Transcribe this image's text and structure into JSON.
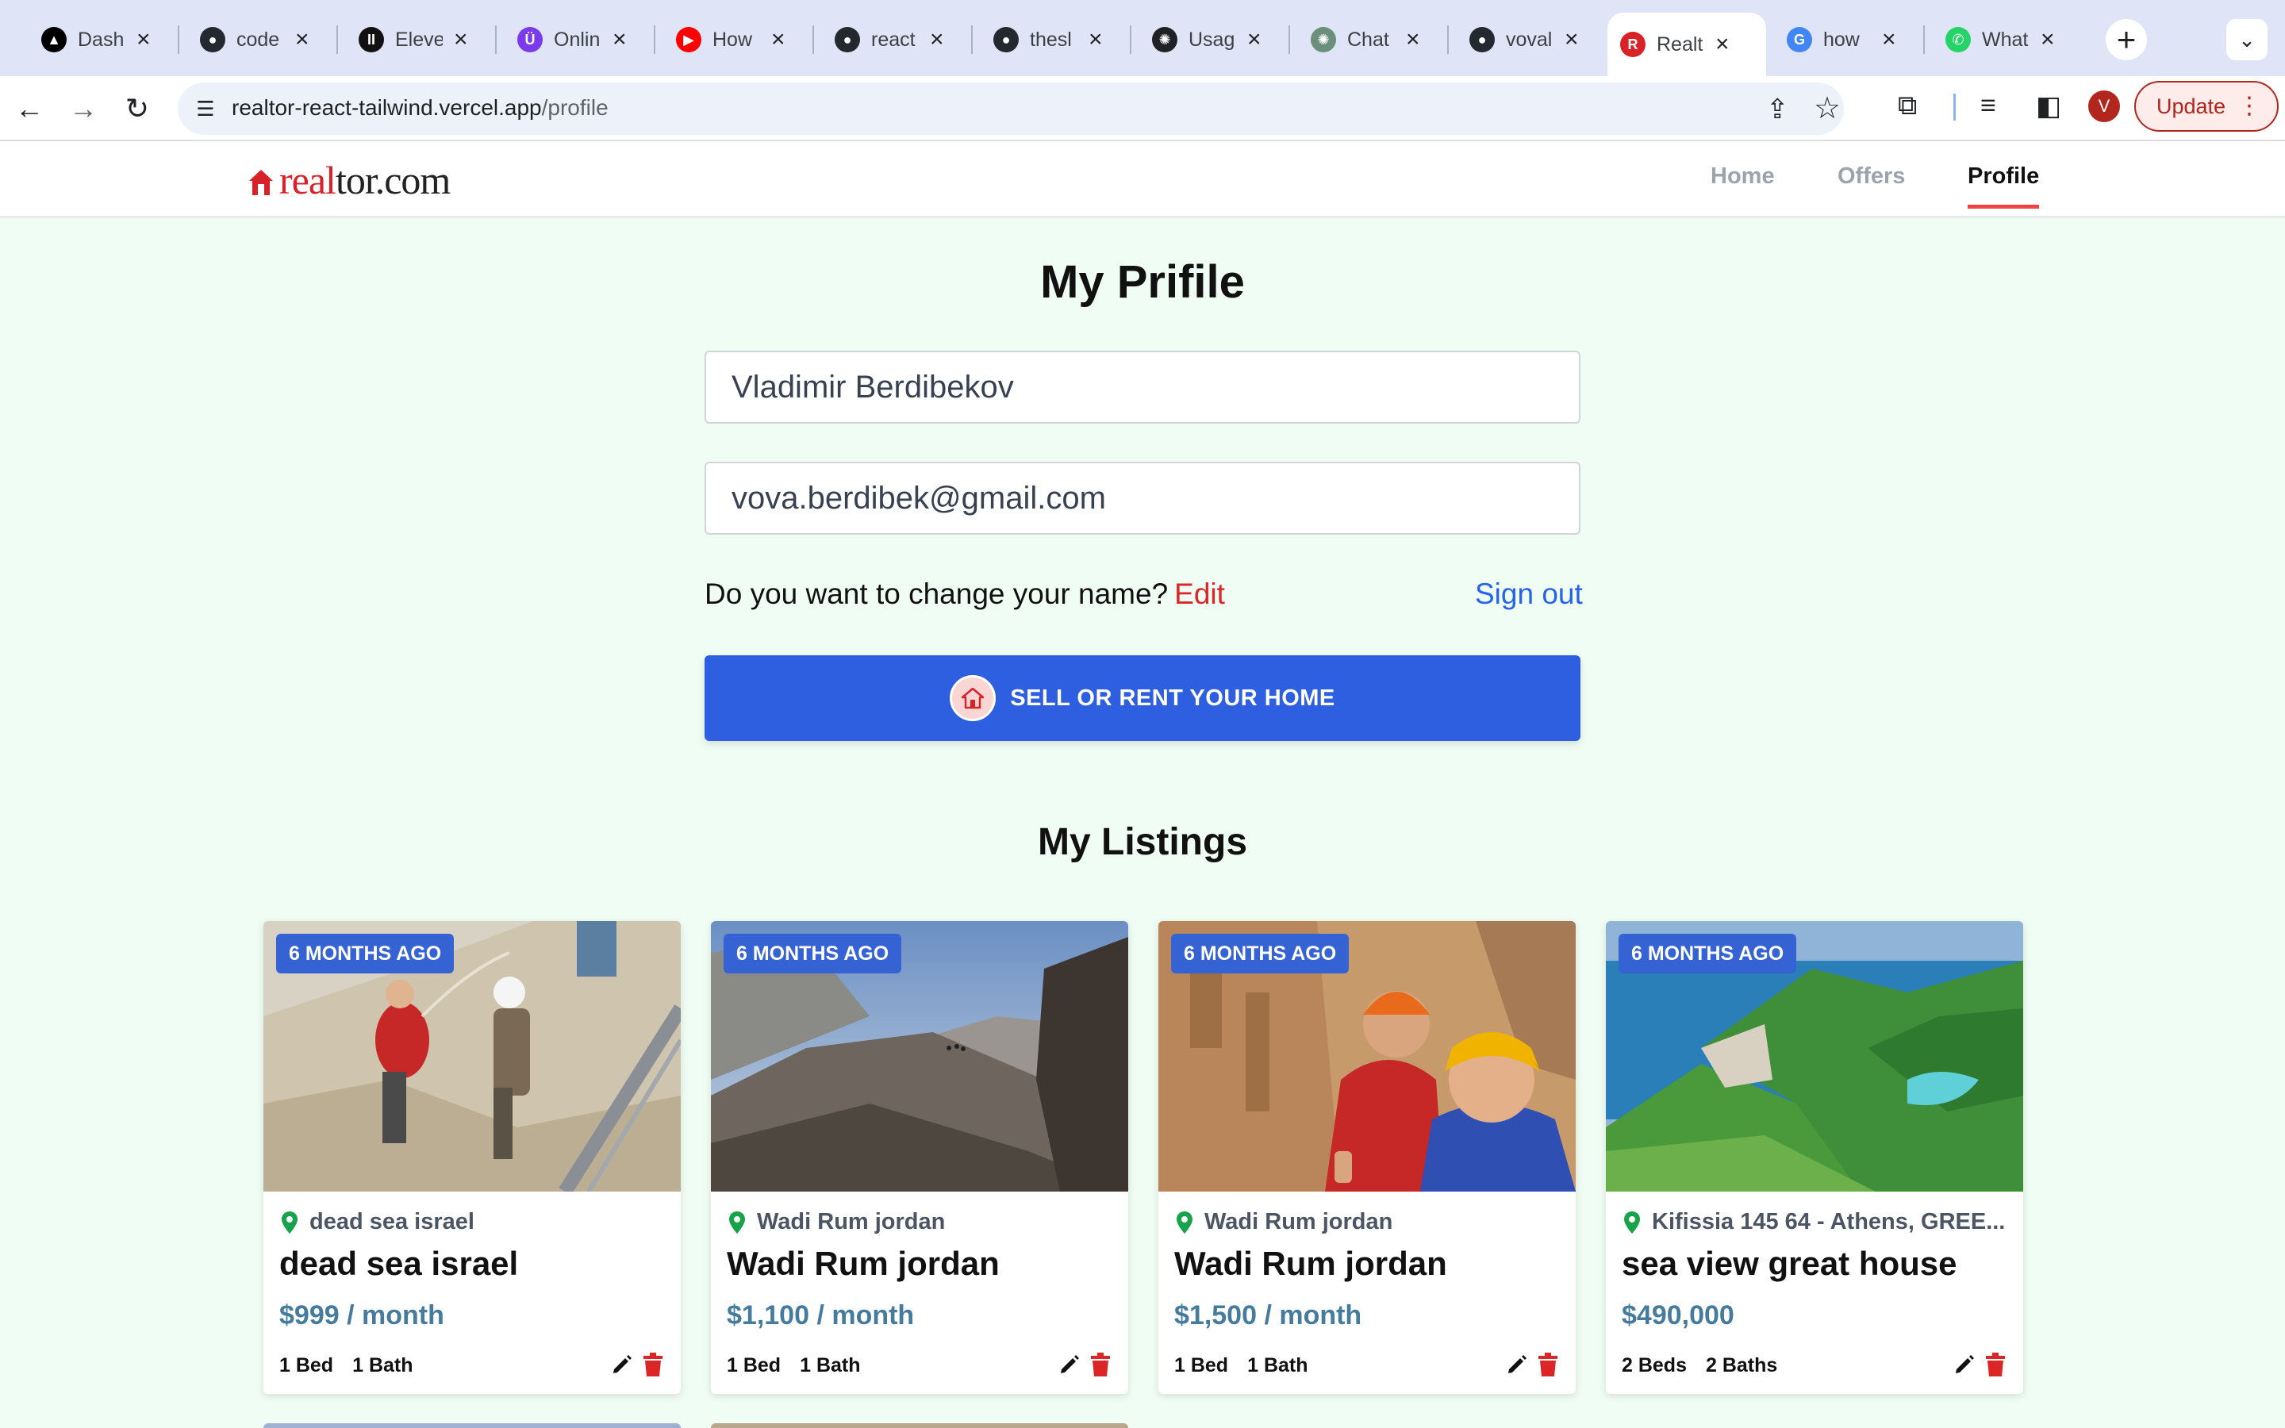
{
  "browser": {
    "tabs": [
      {
        "title": "Dash",
        "icon": "vercel-icon",
        "color": "#000000",
        "glyph": "▲"
      },
      {
        "title": "code",
        "icon": "github-icon",
        "color": "#24292f",
        "glyph": "●"
      },
      {
        "title": "Eleve",
        "icon": "elevenlabs-icon",
        "color": "#111111",
        "glyph": "II"
      },
      {
        "title": "Onlin",
        "icon": "online-icon",
        "color": "#7c3aed",
        "glyph": "Ü"
      },
      {
        "title": "How",
        "icon": "youtube-icon",
        "color": "#ff0000",
        "glyph": "▶"
      },
      {
        "title": "react",
        "icon": "github-icon",
        "color": "#24292f",
        "glyph": "●"
      },
      {
        "title": "thesl",
        "icon": "github-icon",
        "color": "#24292f",
        "glyph": "●"
      },
      {
        "title": "Usag",
        "icon": "openai-icon",
        "color": "#202124",
        "glyph": "✺"
      },
      {
        "title": "Chat",
        "icon": "chatgpt-icon",
        "color": "#6b8f7a",
        "glyph": "✺"
      },
      {
        "title": "voval",
        "icon": "github-icon",
        "color": "#24292f",
        "glyph": "●"
      },
      {
        "title": "Realt",
        "icon": "realtor-icon",
        "color": "#d92228",
        "glyph": "R",
        "active": true
      },
      {
        "title": "how",
        "icon": "google-icon",
        "color": "#4285f4",
        "glyph": "G"
      },
      {
        "title": "What",
        "icon": "whatsapp-icon",
        "color": "#25d366",
        "glyph": "✆"
      }
    ],
    "url_host": "realtor-react-tailwind.vercel.app",
    "url_path": "/profile",
    "avatar_letter": "V",
    "update_label": "Update"
  },
  "site": {
    "logo_real": "real",
    "logo_tor": "tor.com",
    "nav": {
      "home": "Home",
      "offers": "Offers",
      "profile": "Profile"
    }
  },
  "profile": {
    "title": "My Prifile",
    "name": "Vladimir Berdibekov",
    "email": "vova.berdibek@gmail.com",
    "change_question": "Do you want to change your name?",
    "edit_label": "Edit",
    "signout_label": "Sign out",
    "sell_button": "SELL OR RENT YOUR HOME"
  },
  "listings_title": "My Listings",
  "listings": [
    {
      "badge": "6 MONTHS AGO",
      "location": "dead sea israel",
      "name": "dead sea israel",
      "price": "$999 / month",
      "beds": "1 Bed",
      "baths": "1 Bath"
    },
    {
      "badge": "6 MONTHS AGO",
      "location": "Wadi Rum jordan",
      "name": "Wadi Rum jordan",
      "price": "$1,100 / month",
      "beds": "1 Bed",
      "baths": "1 Bath"
    },
    {
      "badge": "6 MONTHS AGO",
      "location": "Wadi Rum jordan",
      "name": "Wadi Rum jordan",
      "price": "$1,500 / month",
      "beds": "1 Bed",
      "baths": "1 Bath"
    },
    {
      "badge": "6 MONTHS AGO",
      "location": "Kifissia 145 64 - Athens, GREE...",
      "name": "sea view great house",
      "price": "$490,000",
      "beds": "2 Beds",
      "baths": "2 Baths"
    }
  ],
  "colors": {
    "accent": "#2e5fe0",
    "brand_red": "#d92228",
    "price": "#457b9d",
    "page_bg": "#f0fdf4"
  }
}
